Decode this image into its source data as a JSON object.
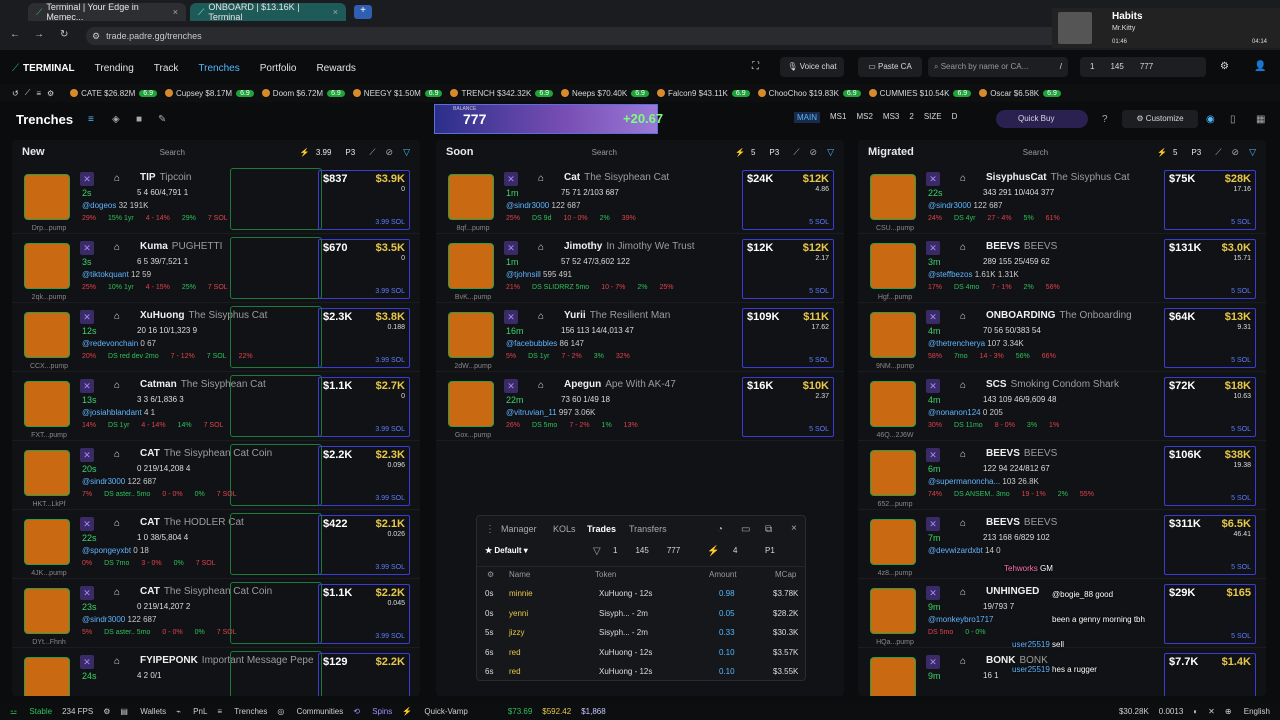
{
  "browser": {
    "tabs": [
      {
        "title": "Terminal | Your Edge in Memec..."
      },
      {
        "title": "ONBOARD | $13.16K | Terminal"
      }
    ],
    "url": "trade.padre.gg/trenches",
    "media": {
      "title": "Habits",
      "artist": "Mr.Kitty",
      "time_start": "01:46",
      "time_end": "04:14"
    }
  },
  "nav": {
    "logo": "TERMINAL",
    "links": [
      "Trending",
      "Track",
      "Trenches",
      "Portfolio",
      "Rewards"
    ],
    "voice": "Voice chat",
    "paste": "Paste CA",
    "search_placeholder": "Search by name or CA...",
    "slash": "/",
    "counts": [
      "1",
      "145",
      "777"
    ]
  },
  "ticker": [
    {
      "sym": "CATE",
      "val": "$26.82M",
      "pct": "6.9"
    },
    {
      "sym": "Cupsey",
      "val": "$8.17M",
      "pct": "6.9"
    },
    {
      "sym": "Doom",
      "val": "$6.72M",
      "pct": "6.9"
    },
    {
      "sym": "NEEGY",
      "val": "$1.50M",
      "pct": "6.9"
    },
    {
      "sym": "TRENCH",
      "val": "$342.32K",
      "pct": "6.9"
    },
    {
      "sym": "Neeps",
      "val": "$70.40K",
      "pct": "6.9"
    },
    {
      "sym": "Falcon9",
      "val": "$43.11K",
      "pct": "6.9"
    },
    {
      "sym": "ChooChoo",
      "val": "$19.83K",
      "pct": "6.9"
    },
    {
      "sym": "CUMMIES",
      "val": "$10.54K",
      "pct": "6.9"
    },
    {
      "sym": "Oscar",
      "val": "$6.58K",
      "pct": "6.9"
    }
  ],
  "title": {
    "text": "Trenches",
    "balance_label": "BALANCE",
    "balance": "777",
    "pnl": "+20.67",
    "modes": [
      "MAIN",
      "MS1",
      "MS2",
      "MS3"
    ],
    "two": "2",
    "size": "SIZE",
    "d": "D",
    "quick_buy": "Quick Buy",
    "customize": "Customize"
  },
  "columns": [
    {
      "name": "New",
      "search": "Search",
      "amt": "3.99",
      "p": "P3",
      "cards": [
        {
          "tk": "TIP",
          "full": "Tipcoin",
          "age": "2s",
          "stats": "5  4  60/4,791  1",
          "handle": "@dogeos",
          "h2": "32  191K",
          "vol": "$837",
          "mc": "$3.9K",
          "f": "0",
          "sol": "3.99 SOL",
          "label": "Drp...pump",
          "pcts": [
            "29%",
            "15% 1yr",
            "4 - 14%",
            "29%",
            "7 SOL"
          ]
        },
        {
          "tk": "Kuma",
          "full": "PUGHETTI",
          "age": "3s",
          "stats": "6  5  39/7,521  1",
          "handle": "@tiktokquant",
          "h2": "12  59",
          "vol": "$670",
          "mc": "$3.5K",
          "f": "0",
          "sol": "3.99 SOL",
          "label": "2qk...pump",
          "pcts": [
            "25%",
            "10% 1yr",
            "4 - 15%",
            "25%",
            "7 SOL"
          ]
        },
        {
          "tk": "XuHuong",
          "full": "The Sisyphus Cat",
          "age": "12s",
          "stats": "20  16  10/1,323  9",
          "handle": "@redevonchain",
          "h2": "0  67",
          "vol": "$2.3K",
          "mc": "$3.8K",
          "f": "0.188",
          "sol": "3.99 SOL",
          "label": "CCX...pump",
          "pcts": [
            "20%",
            "DS red dev 2mo",
            "7 - 12%",
            "7 SOL",
            "22%"
          ]
        },
        {
          "tk": "Catman",
          "full": "The Sisyphean Cat",
          "age": "13s",
          "stats": "3  3  6/1,836  3",
          "handle": "@josiahblandant",
          "h2": "4  1",
          "vol": "$1.1K",
          "mc": "$2.7K",
          "f": "0",
          "sol": "3.99 SOL",
          "label": "FXT...pump",
          "pcts": [
            "14%",
            "DS 1yr",
            "4 - 14%",
            "14%",
            "7 SOL"
          ]
        },
        {
          "tk": "CAT",
          "full": "The Sisyphean Cat Coin",
          "age": "20s",
          "stats": "0  219/14,208  4",
          "handle": "@sindr3000",
          "h2": "122  687",
          "vol": "$2.2K",
          "mc": "$2.3K",
          "f": "0.096",
          "sol": "3.99 SOL",
          "label": "HKT...LkPf",
          "pcts": [
            "7%",
            "DS aster.. 5mo",
            "0 - 0%",
            "0%",
            "7 SOL"
          ]
        },
        {
          "tk": "CAT",
          "full": "The HODLER Cat",
          "age": "22s",
          "stats": "1  0  38/5,804  4",
          "handle": "@spongeyxbt",
          "h2": "0  18",
          "vol": "$422",
          "mc": "$2.1K",
          "f": "0.026",
          "sol": "3.99 SOL",
          "label": "4JK...pump",
          "pcts": [
            "0%",
            "DS 7mo",
            "3 - 0%",
            "0%",
            "7 SOL"
          ]
        },
        {
          "tk": "CAT",
          "full": "The Sisyphean Cat Coin",
          "age": "23s",
          "stats": "0  219/14,207  2",
          "handle": "@sindr3000",
          "h2": "122  687",
          "vol": "$1.1K",
          "mc": "$2.2K",
          "f": "0.045",
          "sol": "3.99 SOL",
          "label": "DYt...Fhnh",
          "pcts": [
            "5%",
            "DS aster.. 5mo",
            "0 - 0%",
            "0%",
            "7 SOL"
          ]
        },
        {
          "tk": "FYIPEPONK",
          "full": "Important Message Pepe",
          "age": "24s",
          "stats": "4  2  0/1",
          "handle": "",
          "h2": "",
          "vol": "$129",
          "mc": "$2.2K",
          "f": "",
          "sol": "",
          "label": "",
          "pcts": []
        }
      ]
    },
    {
      "name": "Soon",
      "search": "Search",
      "amt": "5",
      "p": "P3",
      "cards": [
        {
          "tk": "Cat",
          "full": "The Sisyphean Cat",
          "age": "1m",
          "stats": "75  71  2/103  687",
          "handle": "@sindr3000",
          "h2": "122  687",
          "vol": "$24K",
          "mc": "$12K",
          "f": "4.86",
          "sol": "5 SOL",
          "label": "8qf...pump",
          "pcts": [
            "25%",
            "DS 9d",
            "10 - 0%",
            "2%",
            "39%"
          ]
        },
        {
          "tk": "Jimothy",
          "full": "In Jimothy We Trust",
          "age": "1m",
          "stats": "57  52  47/3,602  122",
          "handle": "@tjohnsill",
          "h2": "595  491",
          "vol": "$12K",
          "mc": "$12K",
          "f": "2.17",
          "sol": "5 SOL",
          "label": "BvK...pump",
          "pcts": [
            "21%",
            "DS SLIDRRZ 5mo",
            "10 - 7%",
            "2%",
            "25%"
          ]
        },
        {
          "tk": "Yurii",
          "full": "The Resilient Man",
          "age": "16m",
          "stats": "156  113  14/4,013  47",
          "handle": "@facebubbles",
          "h2": "86  147",
          "vol": "$109K",
          "mc": "$11K",
          "f": "17.62",
          "sol": "5 SOL",
          "label": "2dW...pump",
          "pcts": [
            "5%",
            "DS 1yr",
            "7 - 2%",
            "3%",
            "32%"
          ]
        },
        {
          "tk": "Apegun",
          "full": "Ape With AK-47",
          "age": "22m",
          "stats": "73  60  1/49  18",
          "handle": "@vitruvian_11",
          "h2": "997  3.06K",
          "vol": "$16K",
          "mc": "$10K",
          "f": "2.37",
          "sol": "5 SOL",
          "label": "Gox...pump",
          "pcts": [
            "26%",
            "DS 5mo",
            "7 - 2%",
            "1%",
            "13%"
          ]
        }
      ]
    },
    {
      "name": "Migrated",
      "search": "Search",
      "amt": "5",
      "p": "P3",
      "cards": [
        {
          "tk": "SisyphusCat",
          "full": "The Sisyphus Cat",
          "age": "22s",
          "stats": "343  291  10/404  377",
          "handle": "@sindr3000",
          "h2": "122  687",
          "vol": "$75K",
          "mc": "$28K",
          "f": "17.16",
          "sol": "5 SOL",
          "label": "CSU...pump",
          "pcts": [
            "24%",
            "DS 4yr",
            "27 - 4%",
            "5%",
            "61%"
          ]
        },
        {
          "tk": "BEEVS",
          "full": "BEEVS",
          "age": "3m",
          "stats": "289  155  25/459  62",
          "handle": "@steffbezos",
          "h2": "1.61K  1.31K",
          "vol": "$131K",
          "mc": "$3.0K",
          "f": "15.71",
          "sol": "5 SOL",
          "label": "Hgf...pump",
          "pcts": [
            "17%",
            "DS 4mo",
            "7 - 1%",
            "2%",
            "56%"
          ]
        },
        {
          "tk": "ONBOARDING",
          "full": "The Onboarding",
          "age": "4m",
          "stats": "70  56  50/383  54",
          "handle": "@thetrencherya",
          "h2": "107  3.34K",
          "vol": "$64K",
          "mc": "$13K",
          "f": "9.31",
          "sol": "5 SOL",
          "label": "9NM...pump",
          "pcts": [
            "58%",
            "7mo",
            "14 - 3%",
            "56%",
            "66%"
          ]
        },
        {
          "tk": "SCS",
          "full": "Smoking Condom Shark",
          "age": "4m",
          "stats": "143  109  46/9,609  48",
          "handle": "@nonanon124",
          "h2": "0  205",
          "vol": "$72K",
          "mc": "$18K",
          "f": "10.63",
          "sol": "5 SOL",
          "label": "46Q...2J6W",
          "pcts": [
            "30%",
            "DS 11mo",
            "8 - 0%",
            "3%",
            "1%"
          ]
        },
        {
          "tk": "BEEVS",
          "full": "BEEVS",
          "age": "6m",
          "stats": "122  94  224/812  67",
          "handle": "@supermanoncha...",
          "h2": "103  26.8K",
          "vol": "$106K",
          "mc": "$38K",
          "f": "19.38",
          "sol": "5 SOL",
          "label": "652...pump",
          "pcts": [
            "74%",
            "DS ANSEM.. 3mo",
            "19 - 1%",
            "2%",
            "55%"
          ]
        },
        {
          "tk": "BEEVS",
          "full": "BEEVS",
          "age": "7m",
          "stats": "213  168  6/829  102",
          "handle": "@devwizardxbt",
          "h2": "14  0",
          "vol": "$311K",
          "mc": "$6.5K",
          "f": "46.41",
          "sol": "5 SOL",
          "label": "4z8...pump",
          "pcts": []
        },
        {
          "tk": "UNHINGED",
          "full": "",
          "age": "9m",
          "stats": "19/793  7",
          "handle": "@monkeybro1717",
          "h2": "",
          "vol": "$29K",
          "mc": "$165",
          "f": "",
          "sol": "5 SOL",
          "label": "HQa...pump",
          "pcts": [
            "DS 5mo",
            "0 - 0%"
          ]
        },
        {
          "tk": "BONK",
          "full": "BONK",
          "age": "9m",
          "stats": "16  1",
          "handle": "",
          "h2": "",
          "vol": "$7.7K",
          "mc": "$1.4K",
          "f": "",
          "sol": "",
          "label": "",
          "pcts": []
        }
      ]
    }
  ],
  "panel": {
    "tabs": [
      "Manager",
      "KOLs",
      "Trades",
      "Transfers"
    ],
    "preset": "Default",
    "counts": [
      "1",
      "145",
      "777"
    ],
    "four": "4",
    "p1": "P1",
    "headers": [
      "Name",
      "Token",
      "Amount",
      "MCap"
    ],
    "rows": [
      {
        "t": "0s",
        "name": "minnie",
        "token": "XuHuong - 12s",
        "amt": "0.98",
        "mc": "$3.78K"
      },
      {
        "t": "0s",
        "name": "yenni",
        "token": "Sisyph... - 2m",
        "amt": "0.05",
        "mc": "$28.2K"
      },
      {
        "t": "5s",
        "name": "jizzy",
        "token": "Sisyph... - 2m",
        "amt": "0.33",
        "mc": "$30.3K"
      },
      {
        "t": "6s",
        "name": "red",
        "token": "XuHuong - 12s",
        "amt": "0.10",
        "mc": "$3.57K"
      },
      {
        "t": "6s",
        "name": "red",
        "token": "XuHuong - 12s",
        "amt": "0.10",
        "mc": "$3.55K"
      }
    ]
  },
  "chat": [
    {
      "user": "Tehworks",
      "msg": "GM"
    },
    {
      "user": "",
      "msg": "@bogie_88 good"
    },
    {
      "user": "",
      "msg": "been a genny morning tbh"
    },
    {
      "user": "user25519",
      "msg": "sell"
    },
    {
      "user": "user25519",
      "msg": "hes a rugger"
    }
  ],
  "status": {
    "stable": "Stable",
    "fps": "234 FPS",
    "wallets": "Wallets",
    "pnl": "PnL",
    "trenches": "Trenches",
    "communities": "Communities",
    "spins": "Spins",
    "quickvamp": "Quick-Vamp",
    "sol": "$73.69",
    "eth": "$592.42",
    "btc": "$1,868",
    "mc": "$30.28K",
    "fee": "0.0013",
    "lang": "English"
  },
  "colors": {
    "accent": "#52b8ff",
    "green": "#2fc15c",
    "red": "#e0434b",
    "blue_border": "#3a3cd6",
    "gold": "#e8c84a"
  }
}
